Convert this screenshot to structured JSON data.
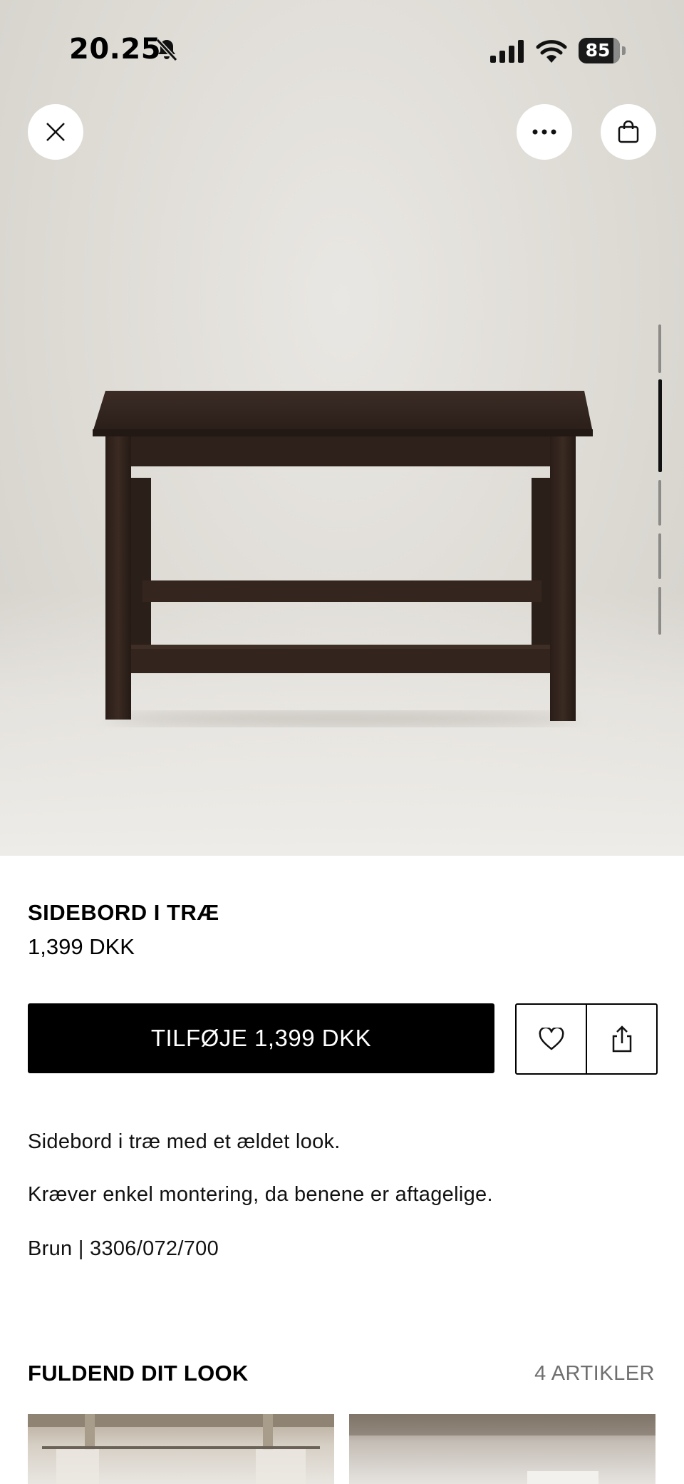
{
  "status_bar": {
    "time": "20.25",
    "battery_level": "85"
  },
  "product": {
    "name": "SIDEBORD I TRÆ",
    "price": "1,399 DKK",
    "add_button_label": "TILFØJE 1,399 DKK",
    "description": [
      "Sidebord i træ med et ældet look.",
      "Kræver enkel montering, da benene er aftagelige.",
      "Brun | 3306/072/700"
    ]
  },
  "gallery": {
    "image_count": 5,
    "active_index": 1
  },
  "complete_look": {
    "title": "FULDEND DIT LOOK",
    "count_label": "4 ARTIKLER"
  },
  "colors": {
    "accent": "#000000",
    "hero_background": "#dedbd5",
    "table_wood": "#3a2a22"
  },
  "icons": [
    "mute-icon",
    "signal-icon",
    "wifi-icon",
    "close-icon",
    "more-icon",
    "shopping-bag-icon",
    "heart-icon",
    "share-icon"
  ]
}
